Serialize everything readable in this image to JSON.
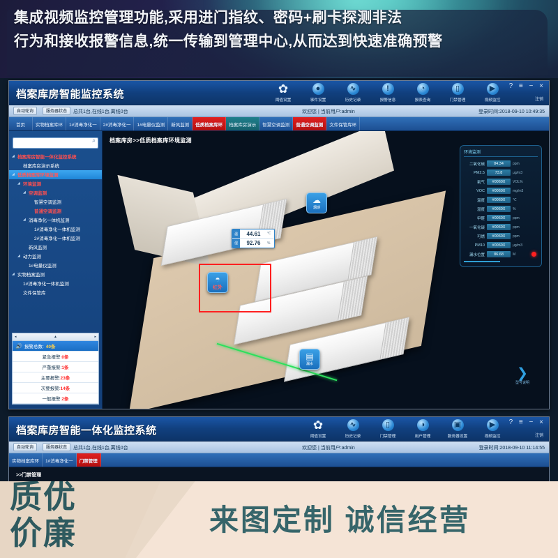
{
  "banner": {
    "line1": "集成视频监控管理功能,采用进门指纹、密码+刷卡探测非法",
    "line2": "行为和接收报警信息,统一传输到管理中心,从而达到快速准确预警"
  },
  "main_window": {
    "app_title": "档案库房智能监控系统",
    "window_controls": "? ≡ − ×",
    "logout_label": "注销",
    "toolbar": [
      {
        "icon": "gear-icon",
        "glyph": "✿",
        "label": "阈值设置"
      },
      {
        "icon": "event-icon",
        "glyph": "●",
        "label": "事件设置"
      },
      {
        "icon": "history-icon",
        "glyph": "∿",
        "label": "历史记录"
      },
      {
        "icon": "alarm-icon",
        "glyph": "!",
        "label": "报警信息"
      },
      {
        "icon": "report-icon",
        "glyph": "◔",
        "label": "报表查询"
      },
      {
        "icon": "door-icon",
        "glyph": "▯",
        "label": "门禁管理"
      },
      {
        "icon": "video-icon",
        "glyph": "▶",
        "label": "视频监控"
      }
    ],
    "status": {
      "auto_poll": "自动轮询",
      "server_state": "服务器状态",
      "server_counts": "总共1台,在线1台,离线0台",
      "welcome": "欢迎您 | 当前用户:admin",
      "login_time": "登录时间:2018-09-10 10:49:35"
    },
    "tabs": [
      {
        "label": "首页",
        "style": "home"
      },
      {
        "label": "实物档案库环",
        "style": "normal"
      },
      {
        "label": "1#消毒净化一",
        "style": "normal"
      },
      {
        "label": "2#消毒净化一",
        "style": "normal"
      },
      {
        "label": "1#电量仪监测",
        "style": "normal"
      },
      {
        "label": "新风监测",
        "style": "normal"
      },
      {
        "label": "低质档案库环",
        "style": "red"
      },
      {
        "label": "档案库房演示",
        "style": "teal"
      },
      {
        "label": "智慧空调监测",
        "style": "normal"
      },
      {
        "label": "普通空调监测",
        "style": "red"
      },
      {
        "label": "文件保管库环",
        "style": "normal"
      }
    ],
    "search": {
      "value": "",
      "placeholder": ""
    },
    "tree": [
      {
        "label": "档案库房智能一体化监控系统",
        "depth": 0,
        "style": "red",
        "arrow": "◢"
      },
      {
        "label": "档案库房演示系统",
        "depth": 1,
        "style": "white",
        "arrow": ""
      },
      {
        "label": "低质档案库环境监测",
        "depth": 0,
        "style": "sel",
        "arrow": "◢"
      },
      {
        "label": "环境监测",
        "depth": 1,
        "style": "red",
        "arrow": "◢"
      },
      {
        "label": "空调监测",
        "depth": 2,
        "style": "red",
        "arrow": "◢"
      },
      {
        "label": "智慧空调监测",
        "depth": 3,
        "style": "white",
        "arrow": ""
      },
      {
        "label": "普通空调监测",
        "depth": 3,
        "style": "red",
        "arrow": ""
      },
      {
        "label": "消毒净化一体机监测",
        "depth": 2,
        "style": "white",
        "arrow": "◢"
      },
      {
        "label": "1#消毒净化一体机监测",
        "depth": 3,
        "style": "white",
        "arrow": ""
      },
      {
        "label": "2#消毒净化一体机监测",
        "depth": 3,
        "style": "white",
        "arrow": ""
      },
      {
        "label": "新风监测",
        "depth": 2,
        "style": "white",
        "arrow": ""
      },
      {
        "label": "动力监测",
        "depth": 1,
        "style": "white",
        "arrow": "◢"
      },
      {
        "label": "1#电量仪监测",
        "depth": 2,
        "style": "white",
        "arrow": ""
      },
      {
        "label": "实物档案监测",
        "depth": 0,
        "style": "white",
        "arrow": "◢"
      },
      {
        "label": "1#消毒净化一体机监测",
        "depth": 1,
        "style": "white",
        "arrow": ""
      },
      {
        "label": "文件保管库",
        "depth": 1,
        "style": "white",
        "arrow": ""
      }
    ],
    "alarm_panel": {
      "header": {
        "left": "◂",
        "center": "▲",
        "right": "▸"
      },
      "rows": [
        {
          "label": "报警总数:",
          "value": "40条",
          "selected": true
        },
        {
          "label": "紧急报警:",
          "value": "0条",
          "selected": false
        },
        {
          "label": "严重报警:",
          "value": "1条",
          "selected": false
        },
        {
          "label": "主要报警:",
          "value": "23条",
          "selected": false
        },
        {
          "label": "次要报警:",
          "value": "14条",
          "selected": false
        },
        {
          "label": "一般报警:",
          "value": "2条",
          "selected": false
        }
      ]
    },
    "breadcrumb": "档案库房>>低质档案库环境监测",
    "scene": {
      "hv_readout": [
        {
          "tag": "温",
          "value": "44.61",
          "unit": "℃"
        },
        {
          "tag": "湿",
          "value": "92.76",
          "unit": "%"
        }
      ],
      "sensors": [
        {
          "name": "smoke-sensor",
          "glyph": "☁",
          "label": "烟感"
        },
        {
          "name": "infrared-sensor",
          "glyph": "◓",
          "label": "红外"
        },
        {
          "name": "water-sensor",
          "glyph": "▤",
          "label": "漏水"
        }
      ],
      "play_badge": {
        "glyph": "❯",
        "label": "型号说明"
      }
    },
    "env_panel": {
      "title": "环境监测",
      "rows": [
        {
          "key": "二氧化碳",
          "value": "84.34",
          "unit": "ppm"
        },
        {
          "key": "PM2.5",
          "value": "73.8",
          "unit": "μg/m3"
        },
        {
          "key": "氧气",
          "value": "#0060X",
          "unit": "VOL%"
        },
        {
          "key": "VOC",
          "value": "#0060X",
          "unit": "mg/m3"
        },
        {
          "key": "温度",
          "value": "#0060X",
          "unit": "℃"
        },
        {
          "key": "湿度",
          "value": "#0060X",
          "unit": "%"
        },
        {
          "key": "甲醛",
          "value": "#0060X",
          "unit": "ppm"
        },
        {
          "key": "一氧化碳",
          "value": "#0060X",
          "unit": "ppm"
        },
        {
          "key": "可燃",
          "value": "#0060X",
          "unit": "ppm"
        },
        {
          "key": "PM10",
          "value": "#0060X",
          "unit": "μg/m3"
        },
        {
          "key": "漏水位置",
          "value": "86.68",
          "unit": "M",
          "dot": true
        }
      ]
    }
  },
  "bottom_window": {
    "app_title": "档案库房智能一体化监控系统",
    "window_controls": "? ≡ − ×",
    "logout_label": "注销",
    "toolbar": [
      {
        "icon": "gear-icon",
        "glyph": "✿",
        "label": "阈值设置"
      },
      {
        "icon": "history-icon",
        "glyph": "∿",
        "label": "历史记录"
      },
      {
        "icon": "door-icon",
        "glyph": "▯",
        "label": "门禁管理"
      },
      {
        "icon": "user-icon",
        "glyph": "◑",
        "label": "用户管理"
      },
      {
        "icon": "server-icon",
        "glyph": "▣",
        "label": "服务器设置"
      },
      {
        "icon": "video-icon",
        "glyph": "▶",
        "label": "视频监控"
      }
    ],
    "status": {
      "auto_poll": "自动轮询",
      "server_state": "服务器状态",
      "server_counts": "总共1台,在线1台,离线0台",
      "welcome": "欢迎您 | 当前用户:admin",
      "login_time": "登录时间:2018-09-10 11:14:55"
    },
    "tabs": [
      {
        "label": "实物档案库环",
        "style": "normal"
      },
      {
        "label": "1#消毒净化一",
        "style": "normal"
      },
      {
        "label": "门禁管理",
        "style": "active"
      }
    ],
    "breadcrumb": ">>门禁管理"
  },
  "promo": {
    "left": "质优\n价廉",
    "left_l1": "质优",
    "left_l2": "价廉",
    "right": "来图定制  诚信经营"
  },
  "colors": {
    "accent_blue": "#1a56a6",
    "alarm_red": "#ff2d2d",
    "active_tab_red": "#e02020",
    "teal_tab": "#1f7f8c",
    "env_value_bg": "#2d7fa8",
    "green_line": "#2ce05c"
  }
}
